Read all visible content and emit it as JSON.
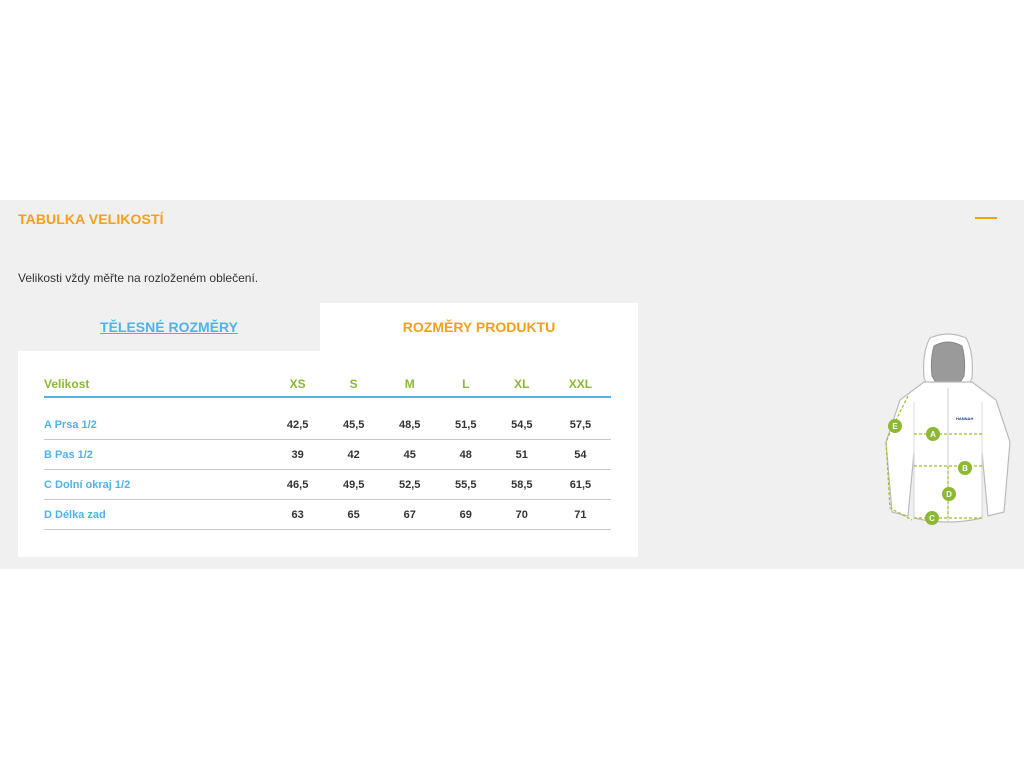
{
  "size_panel": {
    "title": "TABULKA VELIKOSTÍ",
    "intro": "Velikosti vždy měřte na rozloženém oblečení.",
    "tabs": {
      "body": "TĚLESNÉ ROZMĚRY",
      "product": "ROZMĚRY PRODUKTU",
      "active": "product"
    },
    "table": {
      "header_label": "Velikost",
      "sizes": [
        "XS",
        "S",
        "M",
        "L",
        "XL",
        "XXL"
      ],
      "rows": [
        {
          "label": "A Prsa 1/2",
          "values": [
            "42,5",
            "45,5",
            "48,5",
            "51,5",
            "54,5",
            "57,5"
          ]
        },
        {
          "label": "B Pas 1/2",
          "values": [
            "39",
            "42",
            "45",
            "48",
            "51",
            "54"
          ]
        },
        {
          "label": "C Dolní okraj 1/2",
          "values": [
            "46,5",
            "49,5",
            "52,5",
            "55,5",
            "58,5",
            "61,5"
          ]
        },
        {
          "label": "D Délka zad",
          "values": [
            "63",
            "65",
            "67",
            "69",
            "70",
            "71"
          ]
        }
      ]
    },
    "diagram": {
      "markers": [
        "A",
        "B",
        "C",
        "D",
        "E"
      ],
      "brand_text": "HANNAH"
    }
  },
  "colors": {
    "accent_orange": "#f5a015",
    "accent_blue": "#4fb3e8",
    "accent_green": "#8cb833",
    "panel_bg": "#f0f0f0"
  }
}
